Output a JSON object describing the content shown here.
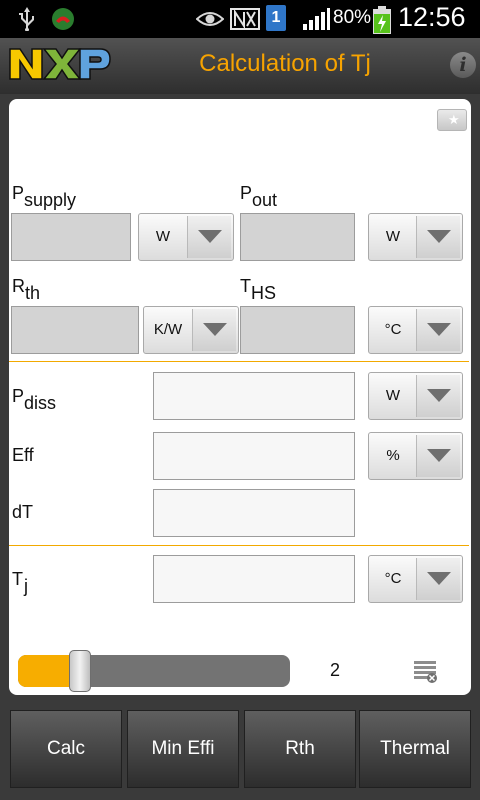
{
  "status_bar": {
    "sim_slot": "1",
    "battery_percent": "80%",
    "time": "12:56"
  },
  "header": {
    "logo_text": "NXP",
    "title": "Calculation of Tj",
    "info_icon": "i"
  },
  "inputs": {
    "psupply": {
      "label": "P",
      "sub": "supply",
      "value": "",
      "unit": "W"
    },
    "pout": {
      "label": "P",
      "sub": "out",
      "value": "",
      "unit": "W"
    },
    "rth": {
      "label": "R",
      "sub": "th",
      "value": "",
      "unit": "K/W"
    },
    "ths": {
      "label": "T",
      "sub": "HS",
      "value": "",
      "unit": "°C"
    }
  },
  "results": {
    "pdiss": {
      "label": "P",
      "sub": "diss",
      "value": "",
      "unit": "W"
    },
    "eff": {
      "label": "Eff",
      "value": "",
      "unit": "%"
    },
    "dt": {
      "label": "dT",
      "value": ""
    },
    "tj": {
      "label": "T",
      "sub": "j",
      "value": "",
      "unit": "°C"
    }
  },
  "slider": {
    "value": "2",
    "fraction": 0.25
  },
  "buttons": {
    "calc": "Calc",
    "min_effi": "Min Effi",
    "rth": "Rth",
    "thermal": "Thermal"
  },
  "colors": {
    "accent": "#f7a300",
    "divider": "#f2a900",
    "slider_fill": "#f7ad00",
    "sim_blue": "#2f76c8",
    "battery_green": "#57c21b"
  },
  "icons": [
    "usb-icon",
    "missed-call-icon",
    "eye-icon",
    "nfc-icon",
    "sim-icon",
    "signal-icon",
    "battery-charging-icon",
    "info-icon",
    "folder-star-icon",
    "dropdown-arrow-icon",
    "clear-list-icon"
  ]
}
